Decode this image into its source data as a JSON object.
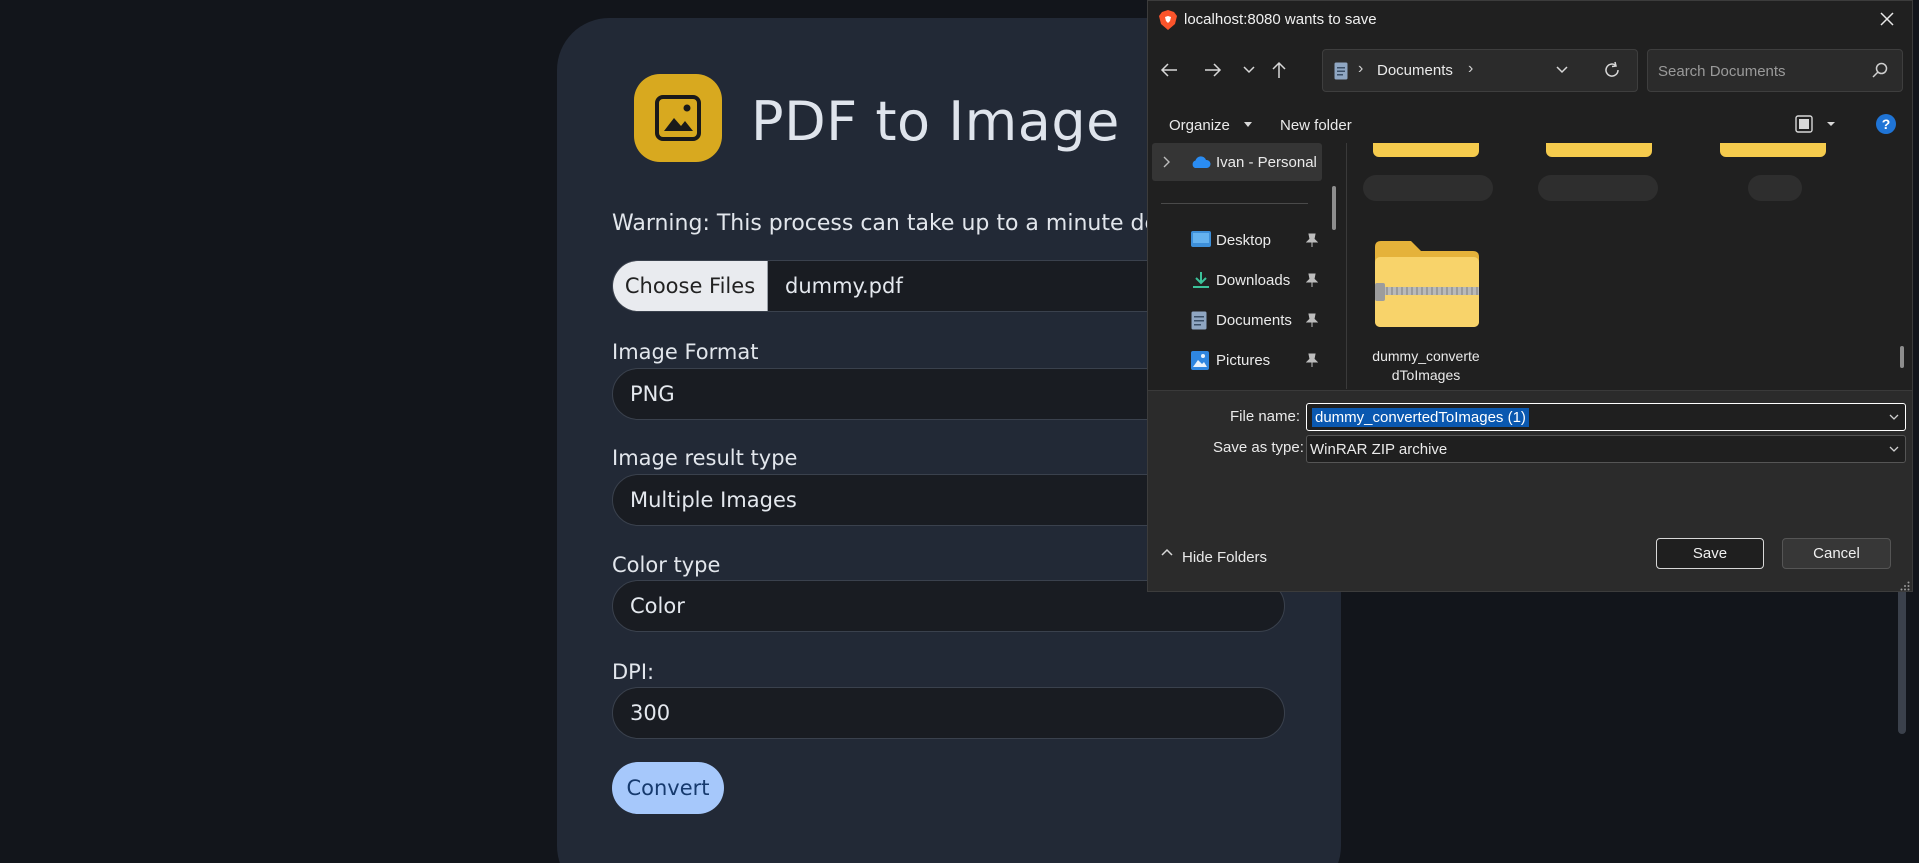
{
  "page": {
    "title": "PDF to Image",
    "warning": "Warning: This process can take up to a minute dependin",
    "file_button": "Choose Files",
    "file_name": "dummy.pdf",
    "format_label": "Image Format",
    "format_value": "PNG",
    "result_label": "Image result type",
    "result_value": "Multiple Images",
    "color_label": "Color type",
    "color_value": "Color",
    "dpi_label": "DPI:",
    "dpi_value": "300",
    "convert_button": "Convert"
  },
  "dialog": {
    "title": "localhost:8080 wants to save",
    "address_folder": "Documents",
    "search_placeholder": "Search Documents",
    "organize": "Organize",
    "new_folder": "New folder",
    "nav_items": [
      {
        "label": "Ivan - Personal",
        "icon": "onedrive-icon"
      },
      {
        "label": "Desktop",
        "icon": "desktop-icon"
      },
      {
        "label": "Downloads",
        "icon": "downloads-icon"
      },
      {
        "label": "Documents",
        "icon": "documents-icon"
      },
      {
        "label": "Pictures",
        "icon": "pictures-icon"
      }
    ],
    "file_item": "dummy_convertedToImages",
    "file_item_line1": "dummy_converte",
    "file_item_line2": "dToImages",
    "file_name_label": "File name:",
    "file_name_value": "dummy_convertedToImages (1)",
    "save_type_label": "Save as type:",
    "save_type_value": "WinRAR ZIP archive",
    "hide_folders": "Hide Folders",
    "save": "Save",
    "cancel": "Cancel"
  },
  "colors": {
    "background": "#12151b",
    "card": "#222936",
    "logo": "#d8a91f",
    "convert": "#a6c8fb",
    "dialog": "#202020",
    "selection": "#0a58b0",
    "help": "#1f74d6",
    "folder": "#f5cb4d"
  }
}
